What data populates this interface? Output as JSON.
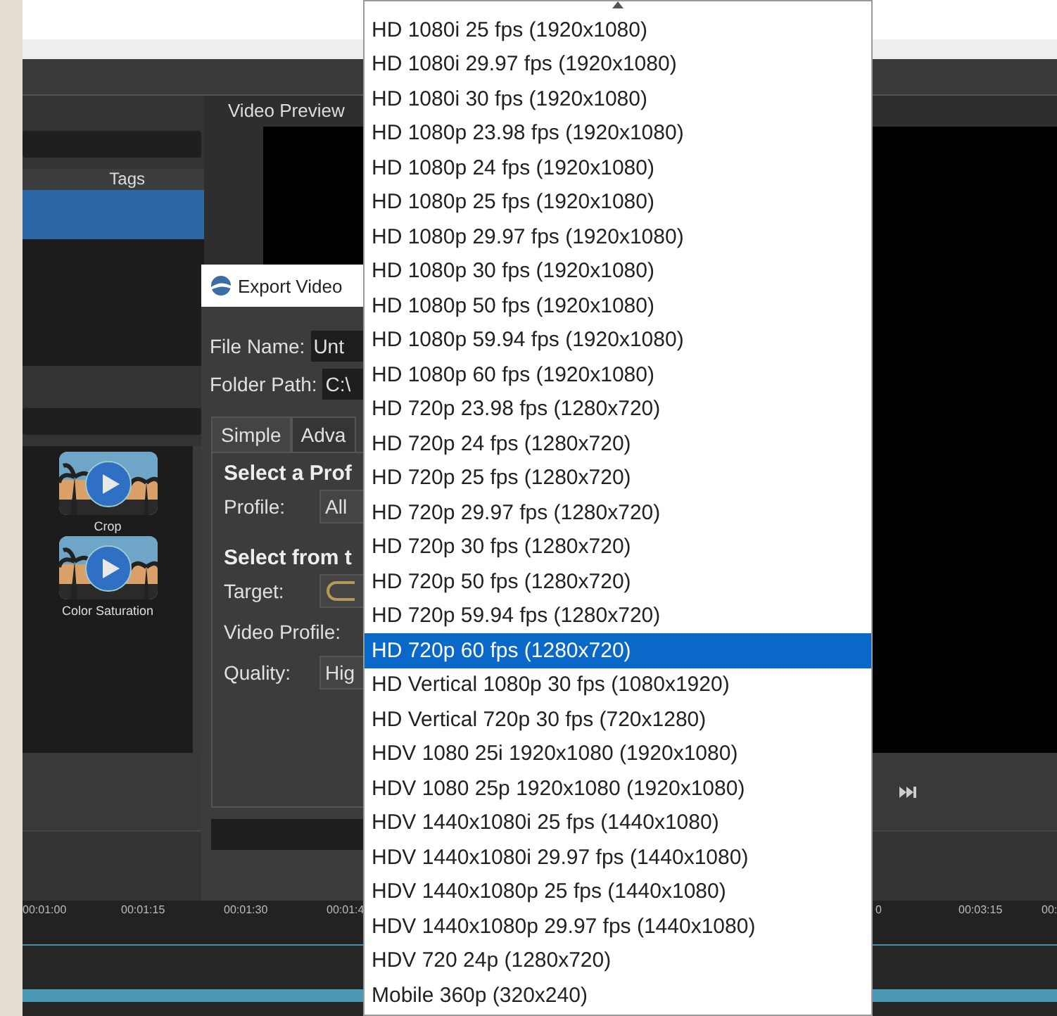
{
  "project_panel": {
    "columns": [
      {
        "label": "Tags"
      }
    ],
    "rows": [
      {
        "selected": true
      }
    ]
  },
  "effects_panel": {
    "effects": [
      {
        "label": "Crop"
      },
      {
        "label": "Color Saturation"
      }
    ]
  },
  "preview_panel": {
    "title": "Video Preview"
  },
  "timeline": {
    "ticks": [
      "00:01:00",
      "00:01:15",
      "00:01:30",
      "00:01:4",
      "0",
      "00:03:15",
      "00:"
    ]
  },
  "export_dialog": {
    "title": "Export Video",
    "fields": [
      {
        "label": "File Name:",
        "value": "Unt"
      },
      {
        "label": "Folder Path:",
        "value": "C:\\"
      }
    ],
    "tabs": [
      {
        "label": "Simple",
        "selected": true
      },
      {
        "label": "Adva",
        "selected": false
      }
    ],
    "sections": [
      {
        "heading": "Select a Prof",
        "rows": [
          {
            "label": "Profile:",
            "kind": "field",
            "value": "All"
          }
        ]
      },
      {
        "heading": "Select from t",
        "rows": [
          {
            "label": "Target:",
            "kind": "icon_field"
          },
          {
            "label": "Video Profile:",
            "kind": "covered"
          },
          {
            "label": "Quality:",
            "kind": "field",
            "value": "Hig"
          }
        ]
      }
    ]
  },
  "profile_list": {
    "items": [
      {
        "label": "HD 1080i 25 fps (1920x1080)",
        "selected": false
      },
      {
        "label": "HD 1080i 29.97 fps (1920x1080)",
        "selected": false
      },
      {
        "label": "HD 1080i 30 fps (1920x1080)",
        "selected": false
      },
      {
        "label": "HD 1080p 23.98 fps (1920x1080)",
        "selected": false
      },
      {
        "label": "HD 1080p 24 fps (1920x1080)",
        "selected": false
      },
      {
        "label": "HD 1080p 25 fps (1920x1080)",
        "selected": false
      },
      {
        "label": "HD 1080p 29.97 fps (1920x1080)",
        "selected": false
      },
      {
        "label": "HD 1080p 30 fps (1920x1080)",
        "selected": false
      },
      {
        "label": "HD 1080p 50 fps (1920x1080)",
        "selected": false
      },
      {
        "label": "HD 1080p 59.94 fps (1920x1080)",
        "selected": false
      },
      {
        "label": "HD 1080p 60 fps (1920x1080)",
        "selected": false
      },
      {
        "label": "HD 720p 23.98 fps (1280x720)",
        "selected": false
      },
      {
        "label": "HD 720p 24 fps (1280x720)",
        "selected": false
      },
      {
        "label": "HD 720p 25 fps (1280x720)",
        "selected": false
      },
      {
        "label": "HD 720p 29.97 fps (1280x720)",
        "selected": false
      },
      {
        "label": "HD 720p 30 fps (1280x720)",
        "selected": false
      },
      {
        "label": "HD 720p 50 fps (1280x720)",
        "selected": false
      },
      {
        "label": "HD 720p 59.94 fps (1280x720)",
        "selected": false
      },
      {
        "label": "HD 720p 60 fps (1280x720)",
        "selected": true
      },
      {
        "label": "HD Vertical 1080p 30 fps (1080x1920)",
        "selected": false
      },
      {
        "label": "HD Vertical 720p 30 fps (720x1280)",
        "selected": false
      },
      {
        "label": "HDV 1080 25i 1920x1080 (1920x1080)",
        "selected": false
      },
      {
        "label": "HDV 1080 25p 1920x1080 (1920x1080)",
        "selected": false
      },
      {
        "label": "HDV 1440x1080i 25 fps (1440x1080)",
        "selected": false
      },
      {
        "label": "HDV 1440x1080i 29.97 fps (1440x1080)",
        "selected": false
      },
      {
        "label": "HDV 1440x1080p 25 fps (1440x1080)",
        "selected": false
      },
      {
        "label": "HDV 1440x1080p 29.97 fps (1440x1080)",
        "selected": false
      },
      {
        "label": "HDV 720 24p (1280x720)",
        "selected": false
      },
      {
        "label": "Mobile 360p (320x240)",
        "selected": false
      }
    ]
  }
}
